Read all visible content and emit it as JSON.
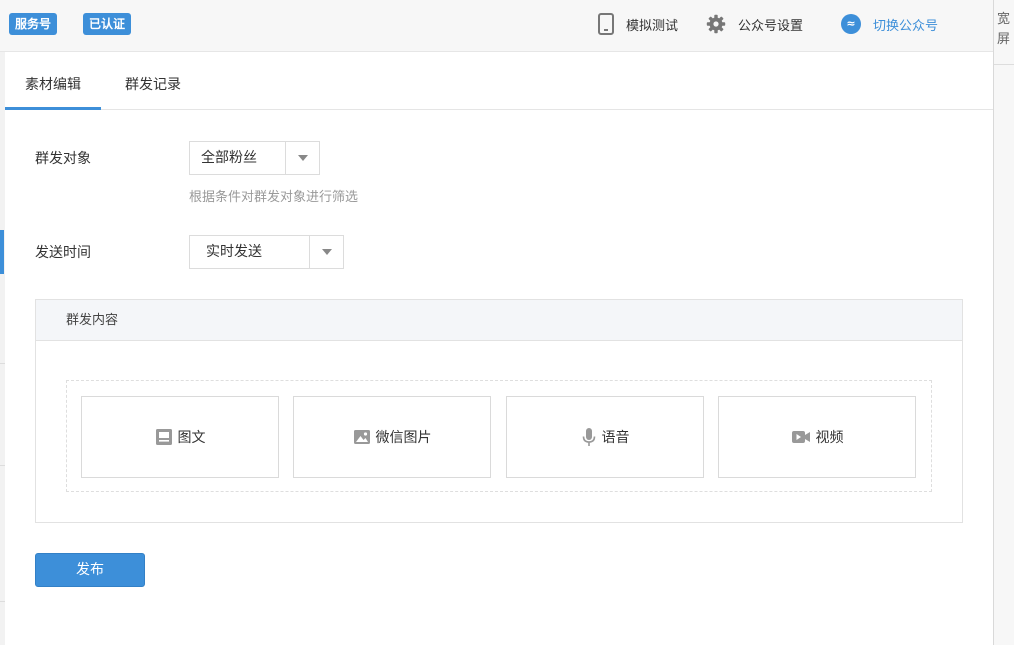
{
  "header": {
    "badge_account_type": "服务号",
    "badge_verified": "已认证",
    "actions": {
      "simulate_test": "模拟测试",
      "account_settings": "公众号设置",
      "switch_account": "切换公众号"
    },
    "switch_icon_glyph": "≈"
  },
  "right_strip": {
    "text": "宽屏"
  },
  "tabs": [
    {
      "label": "素材编辑",
      "active": true
    },
    {
      "label": "群发记录",
      "active": false
    }
  ],
  "form": {
    "target": {
      "label": "群发对象",
      "selected": "全部粉丝",
      "hint": "根据条件对群发对象进行筛选"
    },
    "send_time": {
      "label": "发送时间",
      "selected": "实时发送"
    }
  },
  "content": {
    "title": "群发内容",
    "types": [
      {
        "label": "图文",
        "icon": "article-icon"
      },
      {
        "label": "微信图片",
        "icon": "image-icon"
      },
      {
        "label": "语音",
        "icon": "microphone-icon"
      },
      {
        "label": "视频",
        "icon": "video-icon"
      }
    ]
  },
  "publish_label": "发布",
  "colors": {
    "accent": "#3d8fd9",
    "border": "#dcdcdc",
    "hint": "#999999",
    "panel_header": "#f4f6f9"
  }
}
